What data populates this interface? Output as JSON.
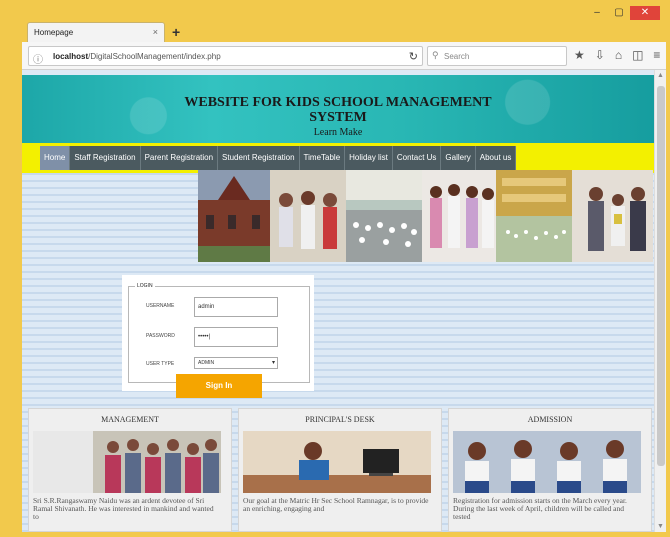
{
  "browser": {
    "tab_title": "Homepage",
    "tab_close": "×",
    "new_tab": "+",
    "url_host": "localhost",
    "url_path": "/DigitalSchoolManagement/index.php",
    "search_placeholder": "Search",
    "window_buttons": [
      "–",
      "▢",
      "✕"
    ]
  },
  "header": {
    "title_line1": "WEBSITE FOR KIDS SCHOOL MANAGEMENT",
    "title_line2": "SYSTEM",
    "subtitle": "Learn Make"
  },
  "menu": {
    "items": [
      {
        "label": "Home"
      },
      {
        "label": "Staff Registration"
      },
      {
        "label": "Parent Registration"
      },
      {
        "label": "Student Registration"
      },
      {
        "label": "TimeTable"
      },
      {
        "label": "Holiday list"
      },
      {
        "label": "Contact Us"
      },
      {
        "label": "Gallery"
      },
      {
        "label": "About us"
      }
    ]
  },
  "login": {
    "legend": "LOGIN",
    "username_label": "USERNAME",
    "username_value": "admin",
    "password_label": "PASSWORD",
    "password_value": "•••••|",
    "usertype_label": "USER TYPE",
    "usertype_value": "ADMIN",
    "signin_label": "Sign In"
  },
  "columns": [
    {
      "title": "MANAGEMENT",
      "text": "Sri S.R.Rangaswamy Naidu was an ardent devotee of Sri Ramal Shivanath. He was interested in mankind and wanted to"
    },
    {
      "title": "PRINCIPAL'S DESK",
      "text": "Our goal at the Matric Hr Sec School Ramnagar, is to provide an enriching, engaging and"
    },
    {
      "title": "ADMISSION",
      "text": "Registration for admission starts on the March every year. During the last week of April, children will be called and tested"
    }
  ],
  "colors": {
    "menu_bar": "#4b5a60",
    "menu_strip": "#f3f000",
    "banner": "#29b7b4",
    "signin": "#f5a500",
    "browser_frame": "#f2c94c"
  }
}
